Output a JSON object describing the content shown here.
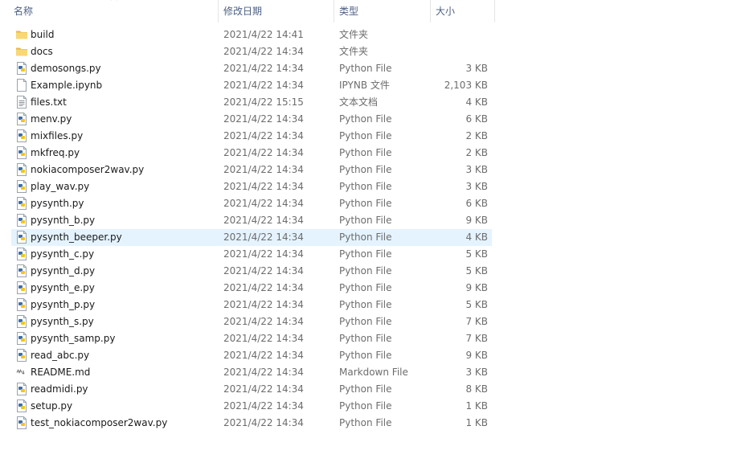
{
  "header": {
    "name": "名称",
    "date": "修改日期",
    "type": "类型",
    "size": "大小"
  },
  "colors": {
    "header_text": "#4d6082",
    "selected_row": "#e5f3ff",
    "folder": "#f8d775",
    "python_blue": "#3a6fb0",
    "python_yellow": "#f5c518"
  },
  "files": [
    {
      "name": "build",
      "date": "2021/4/22 14:41",
      "type": "文件夹",
      "size": "",
      "icon": "folder-icon"
    },
    {
      "name": "docs",
      "date": "2021/4/22 14:34",
      "type": "文件夹",
      "size": "",
      "icon": "folder-icon"
    },
    {
      "name": "demosongs.py",
      "date": "2021/4/22 14:34",
      "type": "Python File",
      "size": "3 KB",
      "icon": "python-file-icon"
    },
    {
      "name": "Example.ipynb",
      "date": "2021/4/22 14:34",
      "type": "IPYNB 文件",
      "size": "2,103 KB",
      "icon": "blank-file-icon"
    },
    {
      "name": "files.txt",
      "date": "2021/4/22 15:15",
      "type": "文本文档",
      "size": "4 KB",
      "icon": "text-file-icon"
    },
    {
      "name": "menv.py",
      "date": "2021/4/22 14:34",
      "type": "Python File",
      "size": "6 KB",
      "icon": "python-file-icon"
    },
    {
      "name": "mixfiles.py",
      "date": "2021/4/22 14:34",
      "type": "Python File",
      "size": "2 KB",
      "icon": "python-file-icon"
    },
    {
      "name": "mkfreq.py",
      "date": "2021/4/22 14:34",
      "type": "Python File",
      "size": "2 KB",
      "icon": "python-file-icon"
    },
    {
      "name": "nokiacomposer2wav.py",
      "date": "2021/4/22 14:34",
      "type": "Python File",
      "size": "3 KB",
      "icon": "python-file-icon"
    },
    {
      "name": "play_wav.py",
      "date": "2021/4/22 14:34",
      "type": "Python File",
      "size": "3 KB",
      "icon": "python-file-icon"
    },
    {
      "name": "pysynth.py",
      "date": "2021/4/22 14:34",
      "type": "Python File",
      "size": "6 KB",
      "icon": "python-file-icon"
    },
    {
      "name": "pysynth_b.py",
      "date": "2021/4/22 14:34",
      "type": "Python File",
      "size": "9 KB",
      "icon": "python-file-icon"
    },
    {
      "name": "pysynth_beeper.py",
      "date": "2021/4/22 14:34",
      "type": "Python File",
      "size": "4 KB",
      "icon": "python-file-icon",
      "selected": true
    },
    {
      "name": "pysynth_c.py",
      "date": "2021/4/22 14:34",
      "type": "Python File",
      "size": "5 KB",
      "icon": "python-file-icon"
    },
    {
      "name": "pysynth_d.py",
      "date": "2021/4/22 14:34",
      "type": "Python File",
      "size": "5 KB",
      "icon": "python-file-icon"
    },
    {
      "name": "pysynth_e.py",
      "date": "2021/4/22 14:34",
      "type": "Python File",
      "size": "9 KB",
      "icon": "python-file-icon"
    },
    {
      "name": "pysynth_p.py",
      "date": "2021/4/22 14:34",
      "type": "Python File",
      "size": "5 KB",
      "icon": "python-file-icon"
    },
    {
      "name": "pysynth_s.py",
      "date": "2021/4/22 14:34",
      "type": "Python File",
      "size": "7 KB",
      "icon": "python-file-icon"
    },
    {
      "name": "pysynth_samp.py",
      "date": "2021/4/22 14:34",
      "type": "Python File",
      "size": "7 KB",
      "icon": "python-file-icon"
    },
    {
      "name": "read_abc.py",
      "date": "2021/4/22 14:34",
      "type": "Python File",
      "size": "9 KB",
      "icon": "python-file-icon"
    },
    {
      "name": "README.md",
      "date": "2021/4/22 14:34",
      "type": "Markdown File",
      "size": "3 KB",
      "icon": "markdown-file-icon"
    },
    {
      "name": "readmidi.py",
      "date": "2021/4/22 14:34",
      "type": "Python File",
      "size": "8 KB",
      "icon": "python-file-icon"
    },
    {
      "name": "setup.py",
      "date": "2021/4/22 14:34",
      "type": "Python File",
      "size": "1 KB",
      "icon": "python-file-icon"
    },
    {
      "name": "test_nokiacomposer2wav.py",
      "date": "2021/4/22 14:34",
      "type": "Python File",
      "size": "1 KB",
      "icon": "python-file-icon"
    }
  ]
}
